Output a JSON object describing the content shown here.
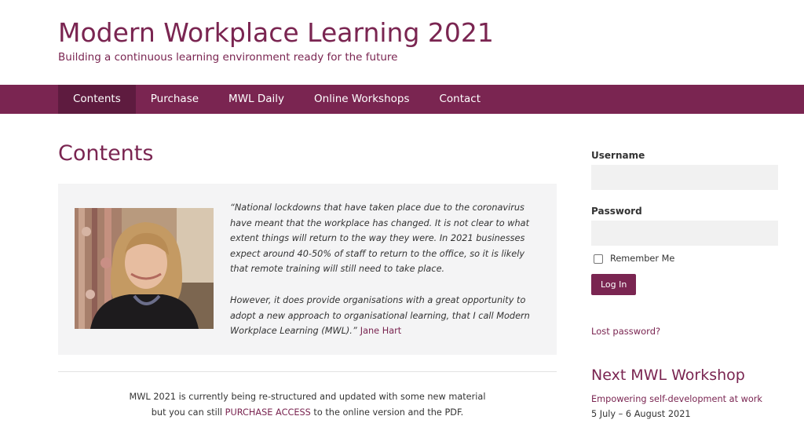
{
  "site": {
    "title": "Modern Workplace Learning 2021",
    "tagline": "Building a continuous learning environment ready for the future"
  },
  "nav": {
    "items": [
      {
        "label": "Contents",
        "active": true
      },
      {
        "label": "Purchase"
      },
      {
        "label": "MWL Daily"
      },
      {
        "label": "Online Workshops"
      },
      {
        "label": "Contact"
      }
    ]
  },
  "main": {
    "page_title": "Contents",
    "quote": {
      "paragraph1": "“National lockdowns that have taken place due to the coronavirus have meant that the workplace has changed. It is not clear to what extent things will return to the way they were.  In 2021 businesses expect around 40-50% of staff to return to the office, so it is likely that remote training will still need to take place.",
      "paragraph2": "However, it does provide organisations with a great opportunity to adopt a new approach to organisational learning, that I call Modern Workplace Learning (MWL).”",
      "author": "Jane Hart"
    },
    "notice": {
      "line1": "MWL 2021 is currently being re-structured and updated with some new material",
      "line2_before": "but you can still",
      "link": "PURCHASE ACCESS",
      "line2_after": "to the online version and the PDF."
    }
  },
  "sidebar": {
    "username_label": "Username",
    "password_label": "Password",
    "remember_label": "Remember Me",
    "login_button": "Log In",
    "lost_password": "Lost password?",
    "workshop_title": "Next MWL Workshop",
    "workshop_name": "Empowering self-development at work",
    "workshop_dates": "5 July – 6 August 2021"
  },
  "colors": {
    "brand": "#7a2551",
    "nav_active": "#5e1b3f",
    "quote_bg": "#f4f4f5"
  }
}
